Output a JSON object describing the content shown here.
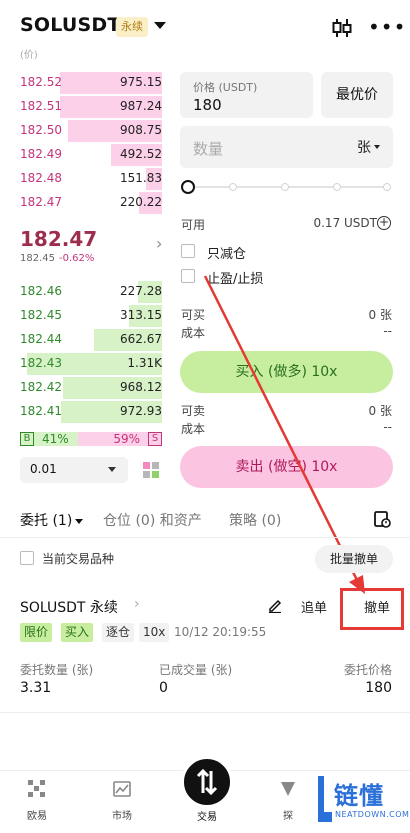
{
  "header": {
    "symbol": "SOLUSDT",
    "contract_type": "永续",
    "more_glyph": "•••"
  },
  "orderbook": {
    "head_label": "(价)",
    "asks": [
      {
        "price": "182.52",
        "qty": "975.15",
        "depth": 0.72
      },
      {
        "price": "182.51",
        "qty": "987.24",
        "depth": 0.72
      },
      {
        "price": "182.50",
        "qty": "908.75",
        "depth": 0.66
      },
      {
        "price": "182.49",
        "qty": "492.52",
        "depth": 0.36
      },
      {
        "price": "182.48",
        "qty": "151.83",
        "depth": 0.11
      },
      {
        "price": "182.47",
        "qty": "220.22",
        "depth": 0.16
      }
    ],
    "last_price": "182.47",
    "mark_price": "182.45",
    "change": "-0.62%",
    "chevron_glyph": "›",
    "bids": [
      {
        "price": "182.46",
        "qty": "227.28",
        "depth": 0.17
      },
      {
        "price": "182.45",
        "qty": "313.15",
        "depth": 0.23
      },
      {
        "price": "182.44",
        "qty": "662.67",
        "depth": 0.48
      },
      {
        "price": "182.43",
        "qty": "1.31K",
        "depth": 0.95
      },
      {
        "price": "182.42",
        "qty": "968.12",
        "depth": 0.7
      },
      {
        "price": "182.41",
        "qty": "972.93",
        "depth": 0.71
      }
    ],
    "buy_ratio_label": "B",
    "buy_ratio": "41%",
    "sell_ratio": "59%",
    "sell_ratio_label": "S",
    "buy_ratio_value": 0.41,
    "precision": "0.01"
  },
  "order_form": {
    "price_label": "价格 (USDT)",
    "price_value": "180",
    "best_price": "最优价",
    "qty_placeholder": "数量",
    "qty_unit": "张",
    "available_label": "可用",
    "available_value": "0.17 USDT",
    "plus_glyph": "+",
    "reduce_only": "只减仓",
    "tp_sl": "止盈/止损",
    "can_buy_label": "可买",
    "can_buy_value": "0 张",
    "cost_label": "成本",
    "cost_value": "--",
    "buy_button": "买入 (做多) 10x",
    "can_sell_label": "可卖",
    "can_sell_value": "0 张",
    "cost2_label": "成本",
    "cost2_value": "--",
    "sell_button": "卖出 (做空) 10x"
  },
  "tabs": [
    {
      "label": "委托 (1)"
    },
    {
      "label": "仓位 (0) 和资产"
    },
    {
      "label": "策略 (0)"
    }
  ],
  "filter": {
    "current_symbol_label": "当前交易品种",
    "batch_cancel": "批量撤单"
  },
  "order": {
    "title": "SOLUSDT 永续",
    "chevron_glyph": "›",
    "chase": "追单",
    "cancel": "撤单",
    "tag_type": "限价",
    "tag_side": "买入",
    "tag_mode": "逐仓",
    "tag_leverage": "10x",
    "time": "10/12 20:19:55",
    "qty_label": "委托数量 (张)",
    "qty_value": "3.31",
    "filled_label": "已成交量 (张)",
    "filled_value": "0",
    "price_label": "委托价格",
    "price_value": "180"
  },
  "bottom_nav": {
    "items": [
      {
        "label": "欧易"
      },
      {
        "label": "市场"
      },
      {
        "label": "交易"
      },
      {
        "label": "探"
      }
    ]
  },
  "watermark": {
    "brand": "链懂",
    "url": "NEATDOWN.COM"
  },
  "colors": {
    "ask": "#c4347a",
    "bid": "#2f8a2a",
    "buy_button": "#c7ee9f",
    "sell_button": "#fbc5e1",
    "highlight": "#e53935",
    "watermark": "#2b6fd8"
  }
}
